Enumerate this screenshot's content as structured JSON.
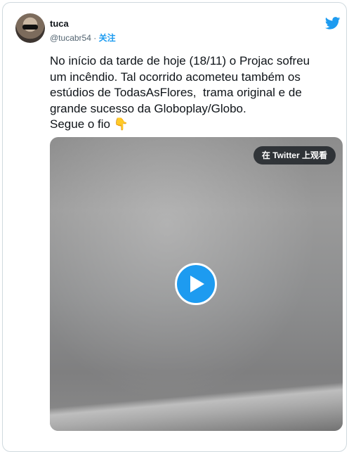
{
  "author": {
    "display_name": "tuca",
    "handle": "@tucabr54",
    "separator": "·",
    "follow_label": "关注"
  },
  "tweet": {
    "text": "No início da tarde de hoje (18/11) o Projac sofreu\num incêndio. Tal ocorrido acometeu também os\nestúdios de TodasAsFlores,  trama original e de\ngrande sucesso da Globoplay/Globo.\nSegue o fio 👇"
  },
  "media": {
    "watch_on_twitter_label": "在 Twitter 上观看"
  },
  "icons": {
    "brand": "twitter-bird-icon",
    "play": "play-icon"
  },
  "colors": {
    "accent": "#1d9bf0",
    "text": "#0f1419",
    "secondary_text": "#536471",
    "border": "#cfd9de"
  }
}
